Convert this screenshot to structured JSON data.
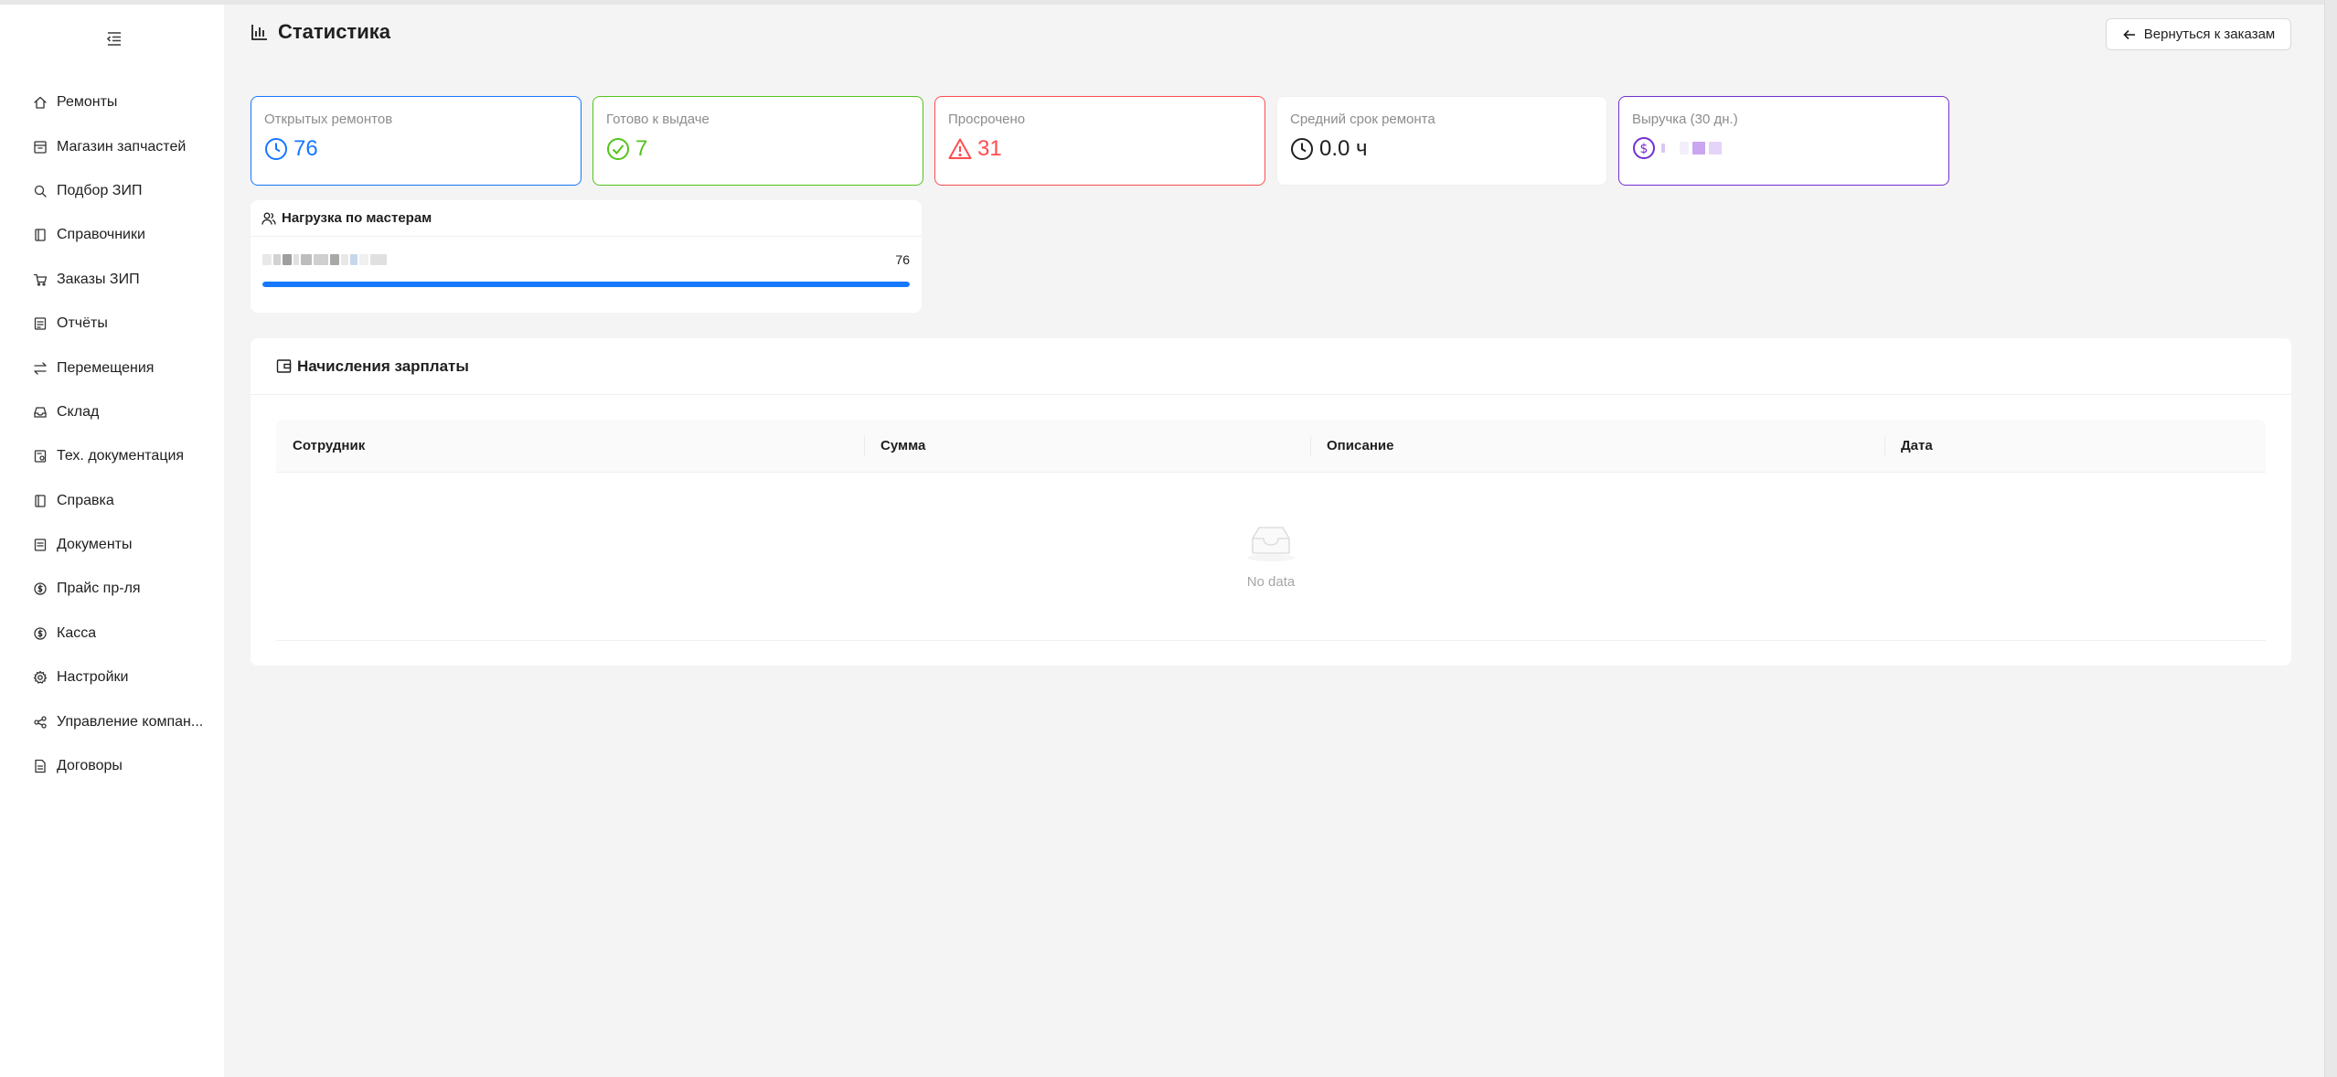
{
  "page": {
    "title": "Статистика",
    "back_button": "Вернуться к заказам"
  },
  "sidebar": {
    "items": [
      {
        "label": "Ремонты",
        "icon": "home-icon"
      },
      {
        "label": "Магазин запчастей",
        "icon": "shop-icon"
      },
      {
        "label": "Подбор ЗИП",
        "icon": "search-icon"
      },
      {
        "label": "Справочники",
        "icon": "book-icon"
      },
      {
        "label": "Заказы ЗИП",
        "icon": "cart-icon"
      },
      {
        "label": "Отчёты",
        "icon": "report-icon"
      },
      {
        "label": "Перемещения",
        "icon": "transfer-icon"
      },
      {
        "label": "Склад",
        "icon": "inbox-icon"
      },
      {
        "label": "Тех. документация",
        "icon": "tech-doc-icon"
      },
      {
        "label": "Справка",
        "icon": "help-book-icon"
      },
      {
        "label": "Документы",
        "icon": "documents-icon"
      },
      {
        "label": "Прайс пр-ля",
        "icon": "dollar-icon"
      },
      {
        "label": "Касса",
        "icon": "cash-icon"
      },
      {
        "label": "Настройки",
        "icon": "gear-icon"
      },
      {
        "label": "Управление компан...",
        "icon": "network-icon"
      },
      {
        "label": "Договоры",
        "icon": "contract-icon"
      }
    ]
  },
  "stats": {
    "open": {
      "label": "Открытых ремонтов",
      "value": "76",
      "color": "#1677ff"
    },
    "ready": {
      "label": "Готово к выдаче",
      "value": "7",
      "color": "#52c41a"
    },
    "overdue": {
      "label": "Просрочено",
      "value": "31",
      "color": "#ff4d4f"
    },
    "avg_time": {
      "label": "Средний срок ремонта",
      "value": "0.0 ч",
      "color": "#1f1f1f"
    },
    "revenue": {
      "label": "Выручка (30 дн.)",
      "color": "#722ed1"
    }
  },
  "workload": {
    "title": "Нагрузка по мастерам",
    "rows": [
      {
        "count": "76",
        "fill_percent": 100
      }
    ]
  },
  "payroll": {
    "title": "Начисления зарплаты",
    "columns": [
      "Сотрудник",
      "Сумма",
      "Описание",
      "Дата"
    ],
    "empty_text": "No data"
  }
}
